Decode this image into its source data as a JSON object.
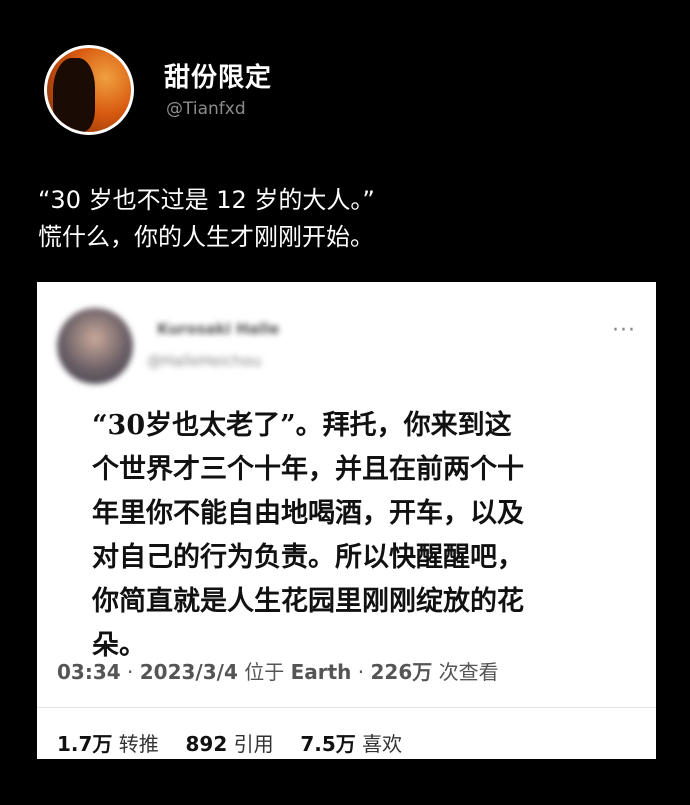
{
  "post": {
    "display_name": "甜份限定",
    "handle": "@Tianfxd",
    "caption_lines": [
      "“30 岁也不过是 12 岁的大人。”",
      "慌什么，你的人生才刚刚开始。"
    ]
  },
  "quoted": {
    "name_blurred": "Kurosaki Halle",
    "handle_blurred": "@HalleHeichou",
    "more_icon": "more-horizontal-icon",
    "text_lines": [
      "“30岁也太老了”。拜托，你来到这",
      "个世界才三个十年，并且在前两个十",
      "年里你不能自由地喝酒，开车，以及",
      "对自己的行为负责。所以快醒醒吧，",
      "你简直就是人生花园里刚刚绽放的花",
      "朵。"
    ],
    "time": "03:34",
    "date": "2023/3/4",
    "location_prefix": "位于",
    "location": "Earth",
    "views_count": "226万",
    "views_label": "次查看",
    "stats": {
      "retweets_count": "1.7万",
      "retweets_label": "转推",
      "quotes_count": "892",
      "quotes_label": "引用",
      "likes_count": "7.5万",
      "likes_label": "喜欢"
    }
  },
  "colors": {
    "background": "#000000",
    "card": "#ffffff",
    "handle": "#8c8c8c",
    "meta": "#555555"
  }
}
